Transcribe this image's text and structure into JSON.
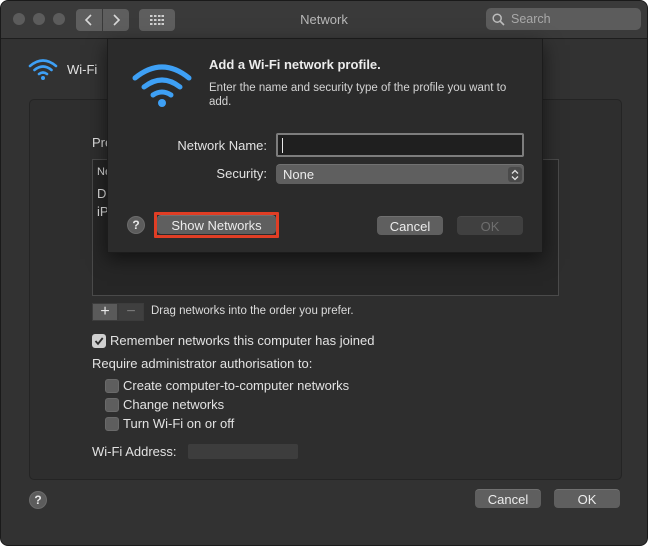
{
  "window": {
    "title": "Network",
    "search_placeholder": "Search"
  },
  "sidebar": {
    "wifi_label": "Wi-Fi"
  },
  "behind": {
    "preferred_label_partial": "Pre",
    "list_rows": [
      "Ne",
      "Di",
      "iP"
    ],
    "drag_hint": "Drag networks into the order you prefer.",
    "plus_label": "+",
    "minus_label": "−",
    "remember_label": "Remember networks this computer has joined",
    "remember_checked": true,
    "require_admin_label": "Require administrator authorisation to:",
    "options": [
      {
        "label": "Create computer-to-computer networks",
        "checked": false
      },
      {
        "label": "Change networks",
        "checked": false
      },
      {
        "label": "Turn Wi-Fi on or off",
        "checked": false
      }
    ],
    "wifi_address_label": "Wi-Fi Address:",
    "help_label": "?",
    "cancel_label": "Cancel",
    "ok_label": "OK"
  },
  "sheet": {
    "title": "Add a Wi-Fi network profile.",
    "description": "Enter the name and security type of the profile you want to add.",
    "network_name_label": "Network Name:",
    "network_name_value": "",
    "security_label": "Security:",
    "security_value": "None",
    "help_label": "?",
    "show_networks_label": "Show Networks",
    "cancel_label": "Cancel",
    "ok_label": "OK",
    "ok_enabled": false,
    "highlight_color": "#e03e25"
  },
  "colors": {
    "window_bg": "#323232",
    "wifi_accent": "#3ea0f5"
  }
}
